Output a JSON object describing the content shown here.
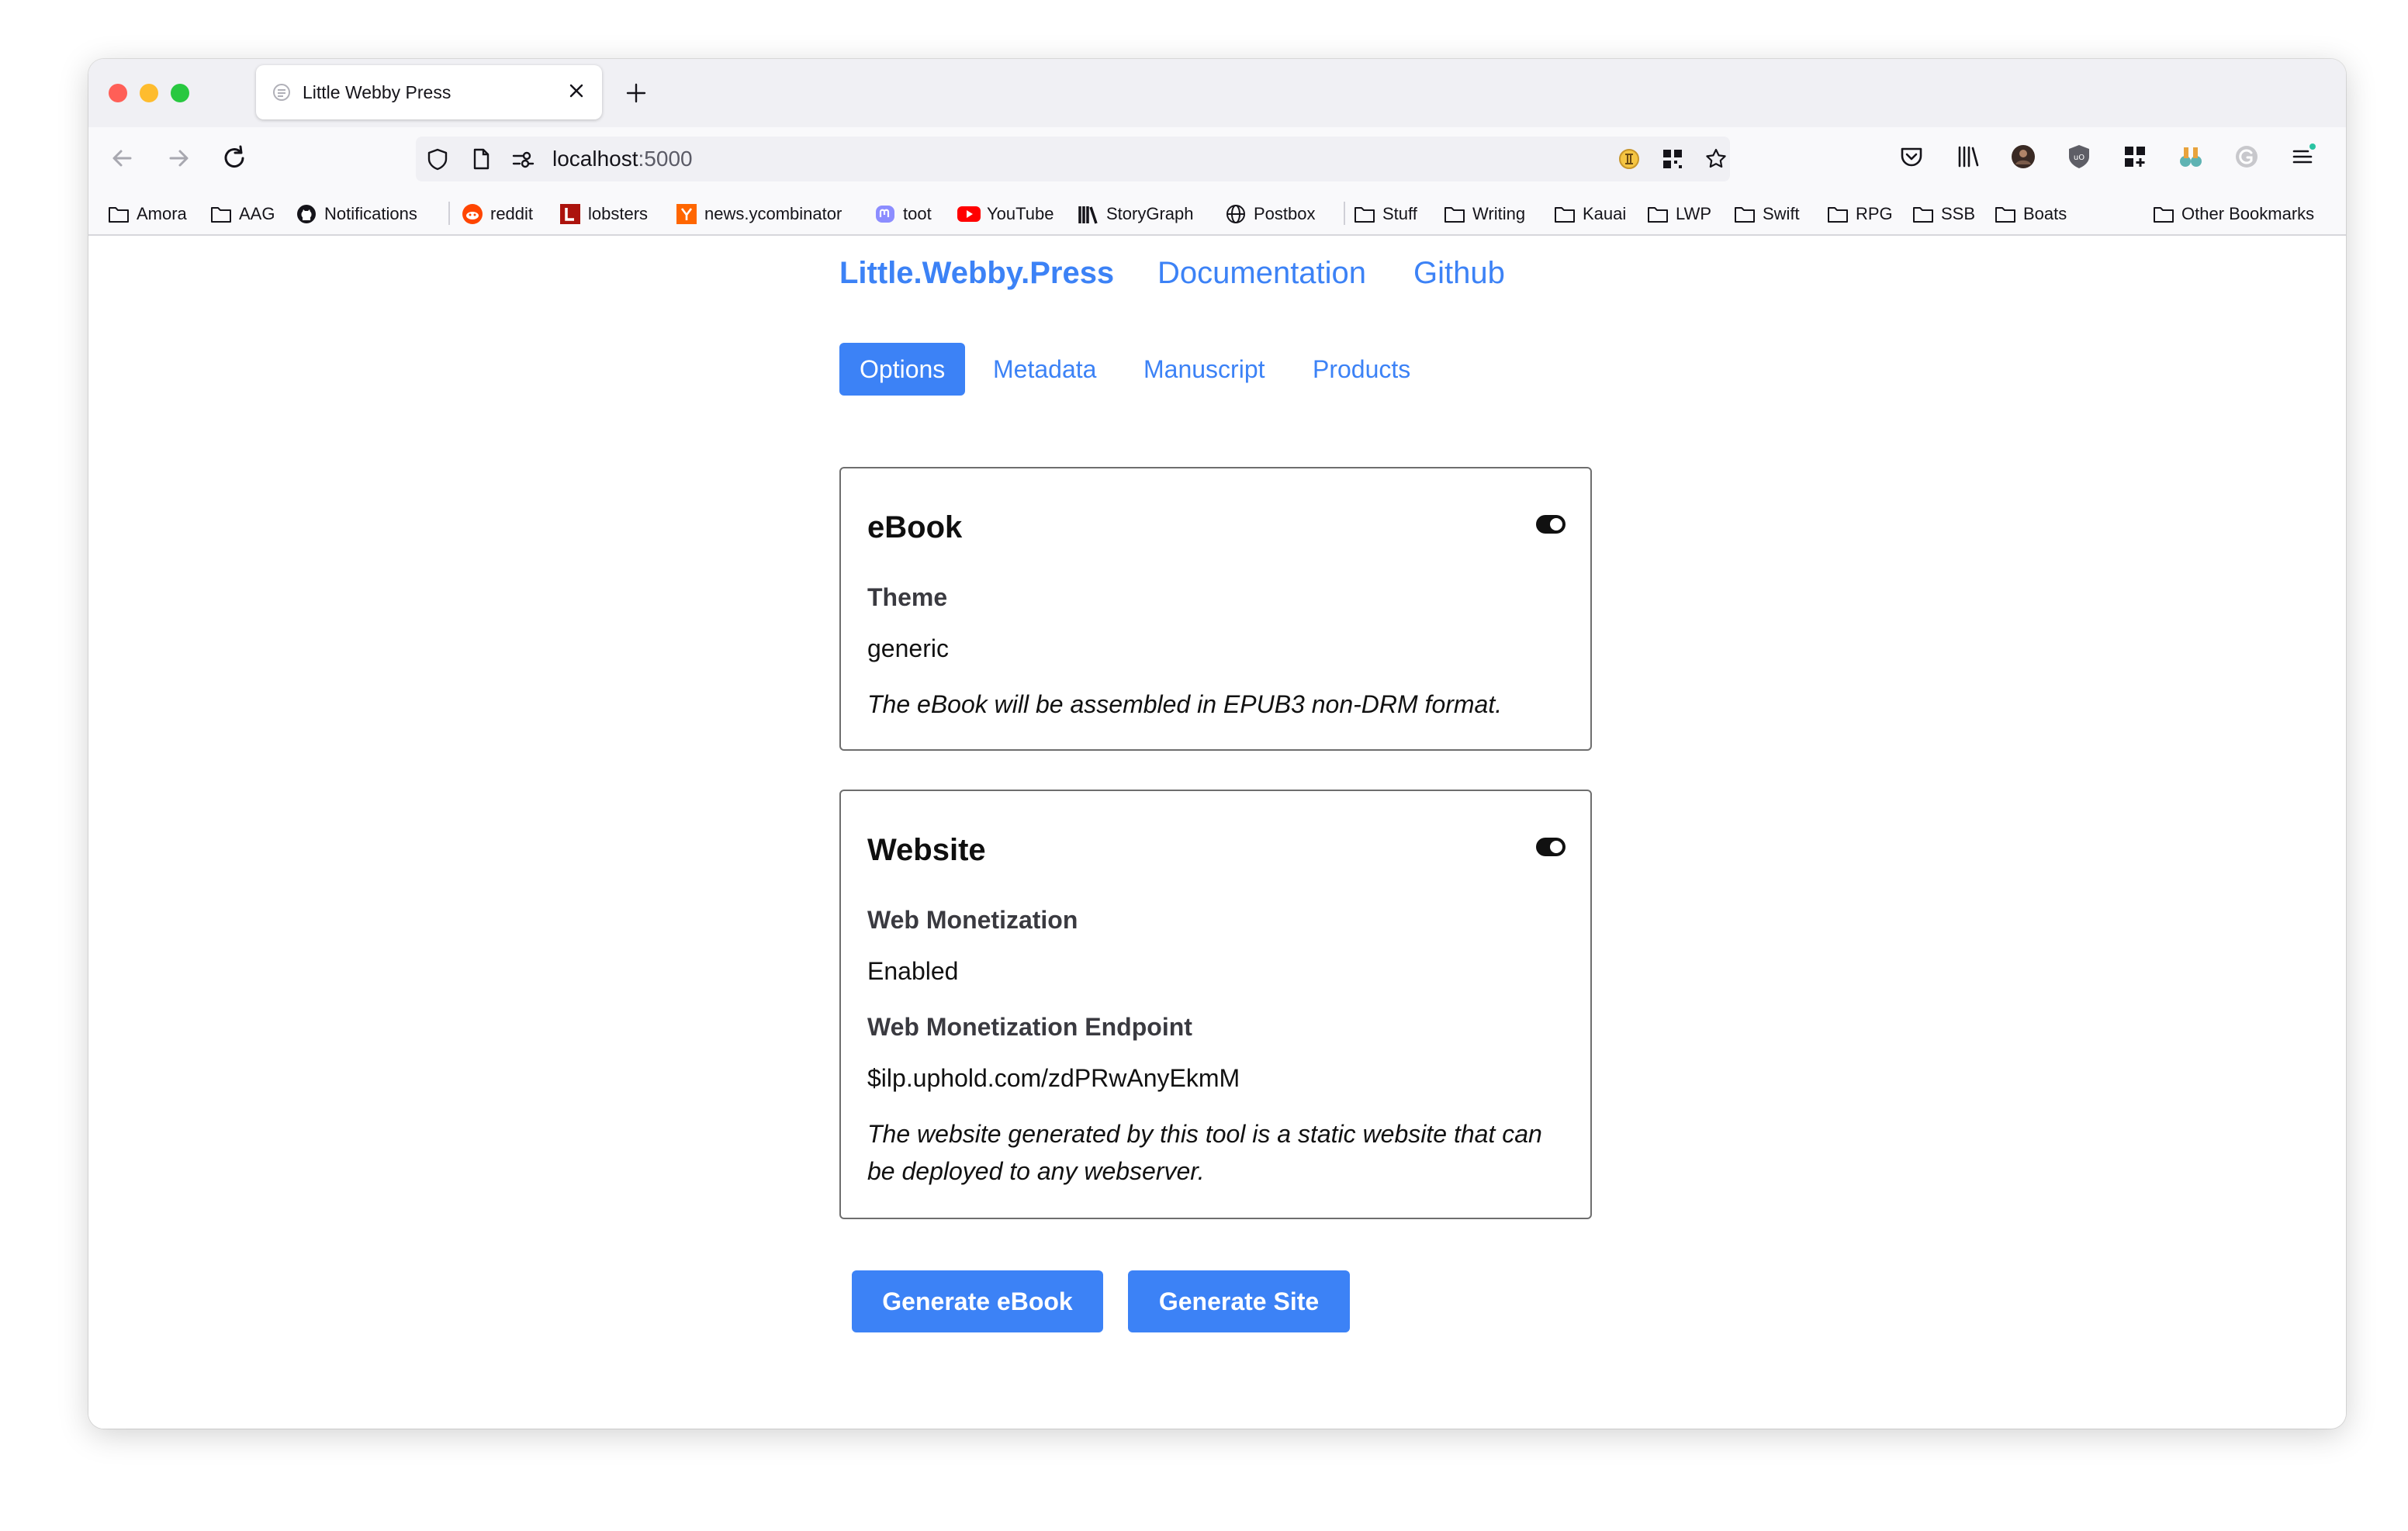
{
  "browser": {
    "tab": {
      "title": "Little Webby Press"
    },
    "url": {
      "host": "localhost",
      "port": ":5000"
    },
    "bookmarks": [
      {
        "label": "Amora",
        "icon": "folder-icon"
      },
      {
        "label": "AAG",
        "icon": "folder-icon"
      },
      {
        "label": "Notifications",
        "icon": "github-icon"
      },
      {
        "label": "reddit",
        "icon": "reddit-icon"
      },
      {
        "label": "lobsters",
        "icon": "lobsters-icon"
      },
      {
        "label": "news.ycombinator",
        "icon": "ycombinator-icon"
      },
      {
        "label": "toot",
        "icon": "mastodon-icon"
      },
      {
        "label": "YouTube",
        "icon": "youtube-icon"
      },
      {
        "label": "StoryGraph",
        "icon": "storygraph-icon"
      },
      {
        "label": "Postbox",
        "icon": "globe-icon"
      },
      {
        "label": "Stuff",
        "icon": "folder-icon"
      },
      {
        "label": "Writing",
        "icon": "folder-icon"
      },
      {
        "label": "Kauai",
        "icon": "folder-icon"
      },
      {
        "label": "LWP",
        "icon": "folder-icon"
      },
      {
        "label": "Swift",
        "icon": "folder-icon"
      },
      {
        "label": "RPG",
        "icon": "folder-icon"
      },
      {
        "label": "SSB",
        "icon": "folder-icon"
      },
      {
        "label": "Boats",
        "icon": "folder-icon"
      }
    ],
    "other_bookmarks": "Other Bookmarks"
  },
  "site": {
    "brand": "Little.Webby.Press",
    "nav": [
      "Documentation",
      "Github"
    ],
    "tabs": [
      "Options",
      "Metadata",
      "Manuscript",
      "Products"
    ],
    "active_tab": "Options"
  },
  "ebook": {
    "title": "eBook",
    "enabled": true,
    "theme_label": "Theme",
    "theme_value": "generic",
    "note": "The eBook will be assembled in EPUB3 non-DRM format."
  },
  "website": {
    "title": "Website",
    "enabled": true,
    "monetization_label": "Web Monetization",
    "monetization_value": "Enabled",
    "endpoint_label": "Web Monetization Endpoint",
    "endpoint_value": "$ilp.uphold.com/zdPRwAnyEkmM",
    "note": "The website generated by this tool is a static website that can be deployed to any webserver."
  },
  "actions": {
    "generate_ebook": "Generate eBook",
    "generate_site": "Generate Site"
  },
  "colors": {
    "accent": "#3c82f6",
    "tabbar_bg": "#f0f0f4",
    "toolbar_bg": "#f9f9fb"
  }
}
